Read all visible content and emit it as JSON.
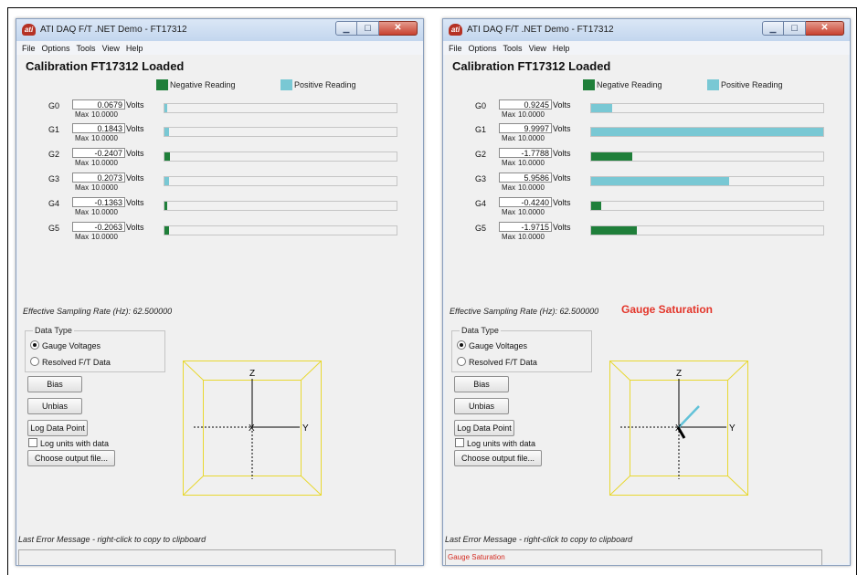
{
  "windows": [
    {
      "title": "ATI DAQ F/T .NET Demo - FT17312",
      "menu": [
        "File",
        "Options",
        "Tools",
        "View",
        "Help"
      ],
      "calibration_title": "Calibration FT17312 Loaded",
      "legend": {
        "negative": "Negative Reading",
        "positive": "Positive Reading"
      },
      "gauges": [
        {
          "label": "G0",
          "value": "0.0679",
          "unit": "Volts",
          "max_label": "Max",
          "max": "10.0000",
          "level": 0.0068
        },
        {
          "label": "G1",
          "value": "0.1843",
          "unit": "Volts",
          "max_label": "Max",
          "max": "10.0000",
          "level": 0.0184
        },
        {
          "label": "G2",
          "value": "-0.2407",
          "unit": "Volts",
          "max_label": "Max",
          "max": "10.0000",
          "level": -0.0241
        },
        {
          "label": "G3",
          "value": "0.2073",
          "unit": "Volts",
          "max_label": "Max",
          "max": "10.0000",
          "level": 0.0207
        },
        {
          "label": "G4",
          "value": "-0.1363",
          "unit": "Volts",
          "max_label": "Max",
          "max": "10.0000",
          "level": -0.0136
        },
        {
          "label": "G5",
          "value": "-0.2063",
          "unit": "Volts",
          "max_label": "Max",
          "max": "10.0000",
          "level": -0.0206
        }
      ],
      "sampling_rate_text": "Effective Sampling Rate (Hz): 62.500000",
      "status_title": "",
      "data_type": {
        "title": "Data Type",
        "options": [
          "Gauge Voltages",
          "Resolved F/T Data"
        ],
        "selected": "Gauge Voltages"
      },
      "buttons": {
        "bias": "Bias",
        "unbias": "Unbias",
        "log": "Log Data Point",
        "choose": "Choose output file..."
      },
      "log_units_label": "Log units with data",
      "log_units_checked": false,
      "axes": {
        "z": "Z",
        "y": "Y",
        "x": "X"
      },
      "vector_shown": false,
      "error_label": "Last Error Message - right-click to copy to clipboard",
      "error_message": ""
    },
    {
      "title": "ATI DAQ F/T .NET Demo - FT17312",
      "menu": [
        "File",
        "Options",
        "Tools",
        "View",
        "Help"
      ],
      "calibration_title": "Calibration FT17312 Loaded",
      "legend": {
        "negative": "Negative Reading",
        "positive": "Positive Reading"
      },
      "gauges": [
        {
          "label": "G0",
          "value": "0.9245",
          "unit": "Volts",
          "max_label": "Max",
          "max": "10.0000",
          "level": 0.0925
        },
        {
          "label": "G1",
          "value": "9.9997",
          "unit": "Volts",
          "max_label": "Max",
          "max": "10.0000",
          "level": 1.0
        },
        {
          "label": "G2",
          "value": "-1.7788",
          "unit": "Volts",
          "max_label": "Max",
          "max": "10.0000",
          "level": -0.1779
        },
        {
          "label": "G3",
          "value": "5.9586",
          "unit": "Volts",
          "max_label": "Max",
          "max": "10.0000",
          "level": 0.5959
        },
        {
          "label": "G4",
          "value": "-0.4240",
          "unit": "Volts",
          "max_label": "Max",
          "max": "10.0000",
          "level": -0.0424
        },
        {
          "label": "G5",
          "value": "-1.9715",
          "unit": "Volts",
          "max_label": "Max",
          "max": "10.0000",
          "level": -0.1972
        }
      ],
      "sampling_rate_text": "Effective Sampling Rate (Hz): 62.500000",
      "status_title": "Gauge Saturation",
      "data_type": {
        "title": "Data Type",
        "options": [
          "Gauge Voltages",
          "Resolved F/T Data"
        ],
        "selected": "Gauge Voltages"
      },
      "buttons": {
        "bias": "Bias",
        "unbias": "Unbias",
        "log": "Log Data Point",
        "choose": "Choose output file..."
      },
      "log_units_label": "Log units with data",
      "log_units_checked": false,
      "axes": {
        "z": "Z",
        "y": "Y",
        "x": "X"
      },
      "vector_shown": true,
      "error_label": "Last Error Message - right-click to copy to clipboard",
      "error_message": "Gauge Saturation"
    }
  ],
  "colors": {
    "negative": "#1f7f3a",
    "positive": "#79c8d4",
    "saturation_text": "#e3362b",
    "box_outline": "#e8d830"
  },
  "icons": {
    "app": "ati-logo-icon",
    "minimize": "minimize-icon",
    "maximize": "maximize-icon",
    "close": "close-icon"
  }
}
